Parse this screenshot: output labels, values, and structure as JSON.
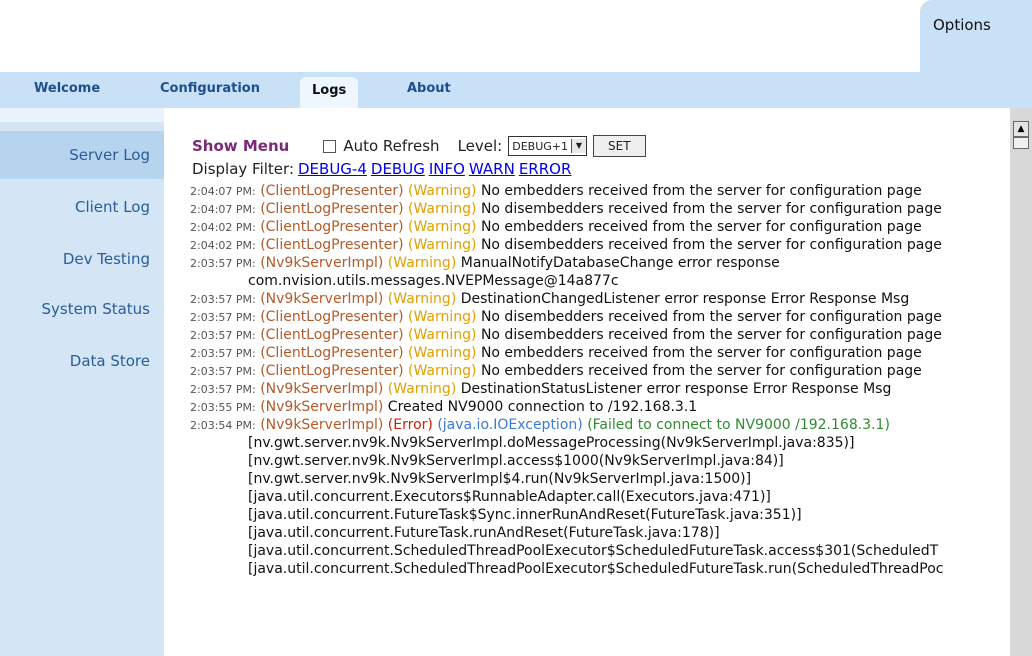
{
  "options_label": "Options",
  "tabs": [
    {
      "label": "Welcome"
    },
    {
      "label": "Configuration"
    },
    {
      "label": "Logs"
    },
    {
      "label": "About"
    }
  ],
  "sidebar": {
    "items": [
      {
        "label": "Server Log"
      },
      {
        "label": "Client Log"
      },
      {
        "label": "Dev Testing"
      },
      {
        "label": "System Status"
      },
      {
        "label": "Data Store"
      }
    ]
  },
  "toolbar": {
    "show_menu": "Show Menu",
    "auto_refresh": "Auto Refresh",
    "level_label": "Level:",
    "level_value": "DEBUG+1",
    "set_label": "SET"
  },
  "filter": {
    "label": "Display Filter:",
    "links": [
      "DEBUG-4",
      "DEBUG",
      "INFO",
      "WARN",
      "ERROR"
    ]
  },
  "log": [
    {
      "ts": "2:04:07 PM:",
      "src": "(ClientLogPresenter)",
      "lvl": "(Warning)",
      "msg": "No embedders received from the server for configuration page"
    },
    {
      "ts": "2:04:07 PM:",
      "src": "(ClientLogPresenter)",
      "lvl": "(Warning)",
      "msg": "No disembedders received from the server for configuration page"
    },
    {
      "ts": "2:04:02 PM:",
      "src": "(ClientLogPresenter)",
      "lvl": "(Warning)",
      "msg": "No embedders received from the server for configuration page"
    },
    {
      "ts": "2:04:02 PM:",
      "src": "(ClientLogPresenter)",
      "lvl": "(Warning)",
      "msg": "No disembedders received from the server for configuration page"
    },
    {
      "ts": "2:03:57 PM:",
      "src": "(Nv9kServerImpl)",
      "lvl": "(Warning)",
      "msg": "ManualNotifyDatabaseChange error response"
    },
    {
      "cont": "com.nvision.utils.messages.NVEPMessage@14a877c"
    },
    {
      "ts": "2:03:57 PM:",
      "src": "(Nv9kServerImpl)",
      "lvl": "(Warning)",
      "msg": "DestinationChangedListener error response Error Response Msg"
    },
    {
      "ts": "2:03:57 PM:",
      "src": "(ClientLogPresenter)",
      "lvl": "(Warning)",
      "msg": "No disembedders received from the server for configuration page"
    },
    {
      "ts": "2:03:57 PM:",
      "src": "(ClientLogPresenter)",
      "lvl": "(Warning)",
      "msg": "No disembedders received from the server for configuration page"
    },
    {
      "ts": "2:03:57 PM:",
      "src": "(ClientLogPresenter)",
      "lvl": "(Warning)",
      "msg": "No embedders received from the server for configuration page"
    },
    {
      "ts": "2:03:57 PM:",
      "src": "(ClientLogPresenter)",
      "lvl": "(Warning)",
      "msg": "No embedders received from the server for configuration page"
    },
    {
      "ts": "2:03:57 PM:",
      "src": "(Nv9kServerImpl)",
      "lvl": "(Warning)",
      "msg": "DestinationStatusListener error response Error Response Msg"
    },
    {
      "ts": "2:03:55 PM:",
      "src": "(Nv9kServerImpl)",
      "lvl": "",
      "msg": "Created NV9000 connection to /192.168.3.1"
    },
    {
      "ts": "2:03:54 PM:",
      "src": "(Nv9kServerImpl)",
      "lvl": "(Error)",
      "exc": "(java.io.IOException)",
      "msg": "(Failed to connect to NV9000 /192.168.3.1)"
    },
    {
      "stack": "[nv.gwt.server.nv9k.Nv9kServerImpl.doMessageProcessing(Nv9kServerImpl.java:835)]"
    },
    {
      "stack": "[nv.gwt.server.nv9k.Nv9kServerImpl.access$1000(Nv9kServerImpl.java:84)]"
    },
    {
      "stack": "[nv.gwt.server.nv9k.Nv9kServerImpl$4.run(Nv9kServerImpl.java:1500)]"
    },
    {
      "stack": "[java.util.concurrent.Executors$RunnableAdapter.call(Executors.java:471)]"
    },
    {
      "stack": "[java.util.concurrent.FutureTask$Sync.innerRunAndReset(FutureTask.java:351)]"
    },
    {
      "stack": "[java.util.concurrent.FutureTask.runAndReset(FutureTask.java:178)]"
    },
    {
      "stack": "[java.util.concurrent.ScheduledThreadPoolExecutor$ScheduledFutureTask.access$301(ScheduledT"
    },
    {
      "stack": "[java.util.concurrent.ScheduledThreadPoolExecutor$ScheduledFutureTask.run(ScheduledThreadPoc"
    }
  ]
}
